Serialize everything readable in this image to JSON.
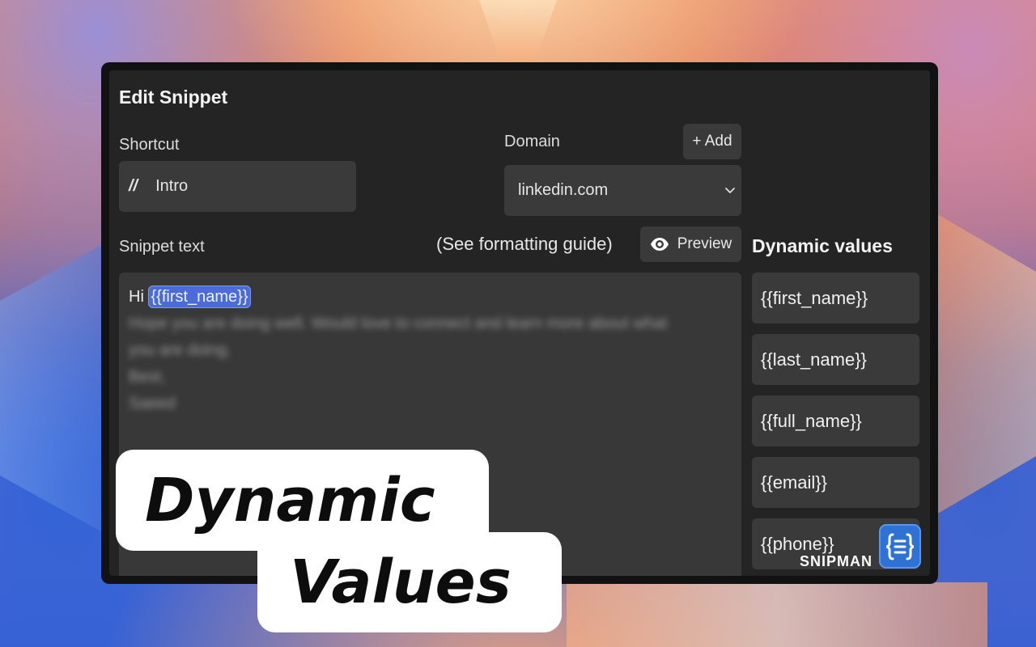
{
  "editor": {
    "title": "Edit Snippet",
    "shortcut_label": "Shortcut",
    "shortcut_prefix": "//",
    "shortcut_value": "Intro",
    "domain_label": "Domain",
    "add_button": "+ Add",
    "domain_value": "linkedin.com",
    "snippet_label": "Snippet text",
    "formatting_guide": "(See formatting guide)",
    "preview_button": "Preview",
    "snippet_greeting": "Hi",
    "snippet_token": "{{first_name}}",
    "snippet_line1": "Hope you are doing well. Would love to connect and learn more about what",
    "snippet_line2": "you are doing.",
    "snippet_line3": "Best,",
    "snippet_line4": "Saeed"
  },
  "dynamic_values": {
    "title": "Dynamic values",
    "items": [
      "{{first_name}}",
      "{{last_name}}",
      "{{full_name}}",
      "{{email}}",
      "{{phone}}"
    ]
  },
  "brand": {
    "name": "SNIPMAN",
    "color": "#2f72d6"
  },
  "overlay": {
    "line1": "Dynamic",
    "line2": "Values"
  }
}
